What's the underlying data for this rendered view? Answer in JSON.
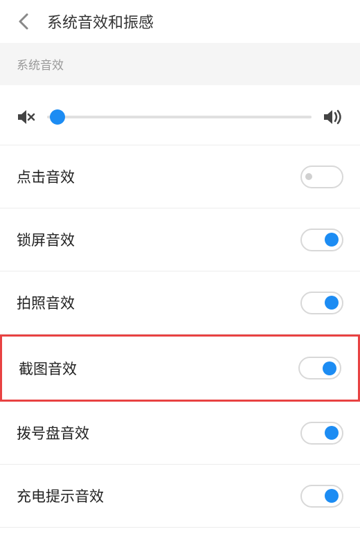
{
  "header": {
    "title": "系统音效和振感"
  },
  "section": {
    "label": "系统音效"
  },
  "volume": {
    "percent": 4
  },
  "settings": [
    {
      "key": "click",
      "label": "点击音效",
      "on": false,
      "highlighted": false
    },
    {
      "key": "lockscreen",
      "label": "锁屏音效",
      "on": true,
      "highlighted": false
    },
    {
      "key": "camera",
      "label": "拍照音效",
      "on": true,
      "highlighted": false
    },
    {
      "key": "screenshot",
      "label": "截图音效",
      "on": true,
      "highlighted": true
    },
    {
      "key": "dialpad",
      "label": "拨号盘音效",
      "on": true,
      "highlighted": false
    },
    {
      "key": "charging",
      "label": "充电提示音效",
      "on": true,
      "highlighted": false
    }
  ]
}
